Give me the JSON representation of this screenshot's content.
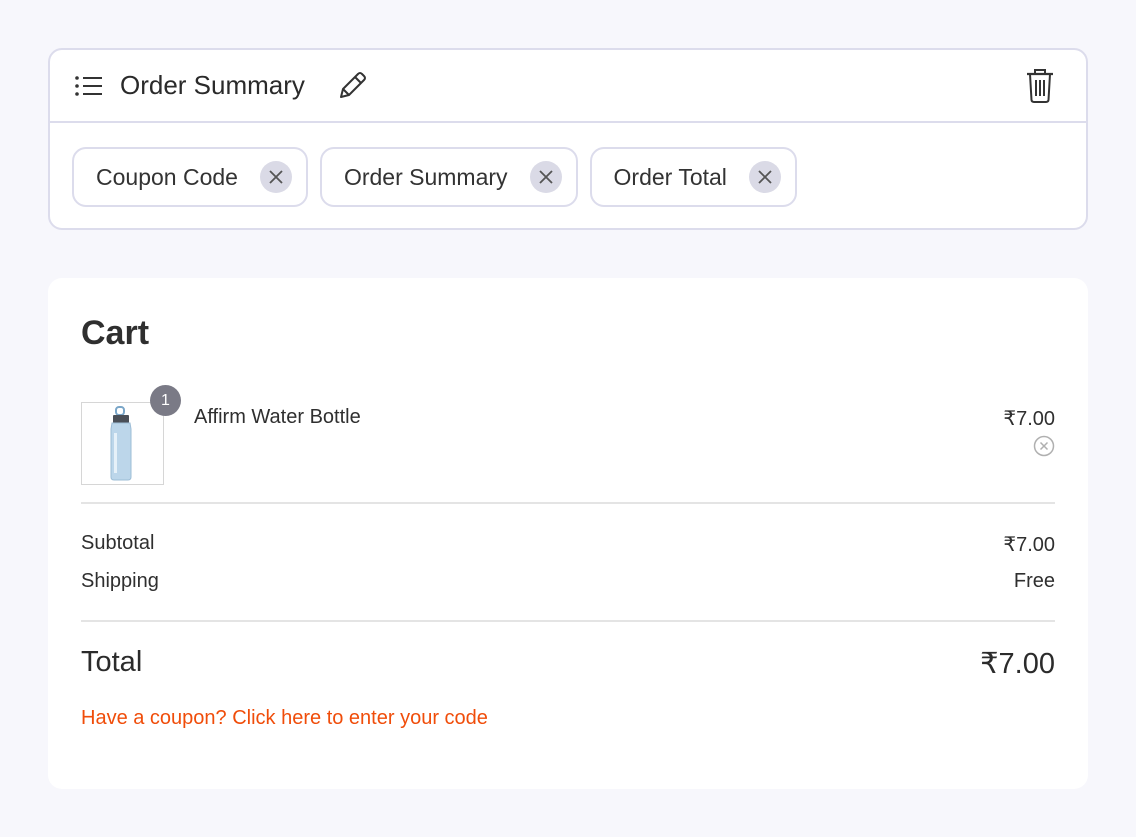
{
  "panel": {
    "title": "Order Summary",
    "chips": [
      {
        "label": "Coupon Code"
      },
      {
        "label": "Order Summary"
      },
      {
        "label": "Order Total"
      }
    ]
  },
  "cart": {
    "title": "Cart",
    "item": {
      "quantity": "1",
      "name": "Affirm Water Bottle",
      "price": "₹7.00"
    },
    "subtotal_label": "Subtotal",
    "subtotal_value": "₹7.00",
    "shipping_label": "Shipping",
    "shipping_value": "Free",
    "total_label": "Total",
    "total_value": "₹7.00",
    "coupon_link": "Have a coupon? Click here to enter your code"
  },
  "colors": {
    "background": "#f7f7fc",
    "border": "#dcdcec",
    "link": "#f04d0a",
    "badge": "#7a7a86"
  },
  "icons": [
    "list-icon",
    "pencil-icon",
    "trash-icon",
    "close-icon",
    "remove-circle-icon",
    "water-bottle-image"
  ]
}
